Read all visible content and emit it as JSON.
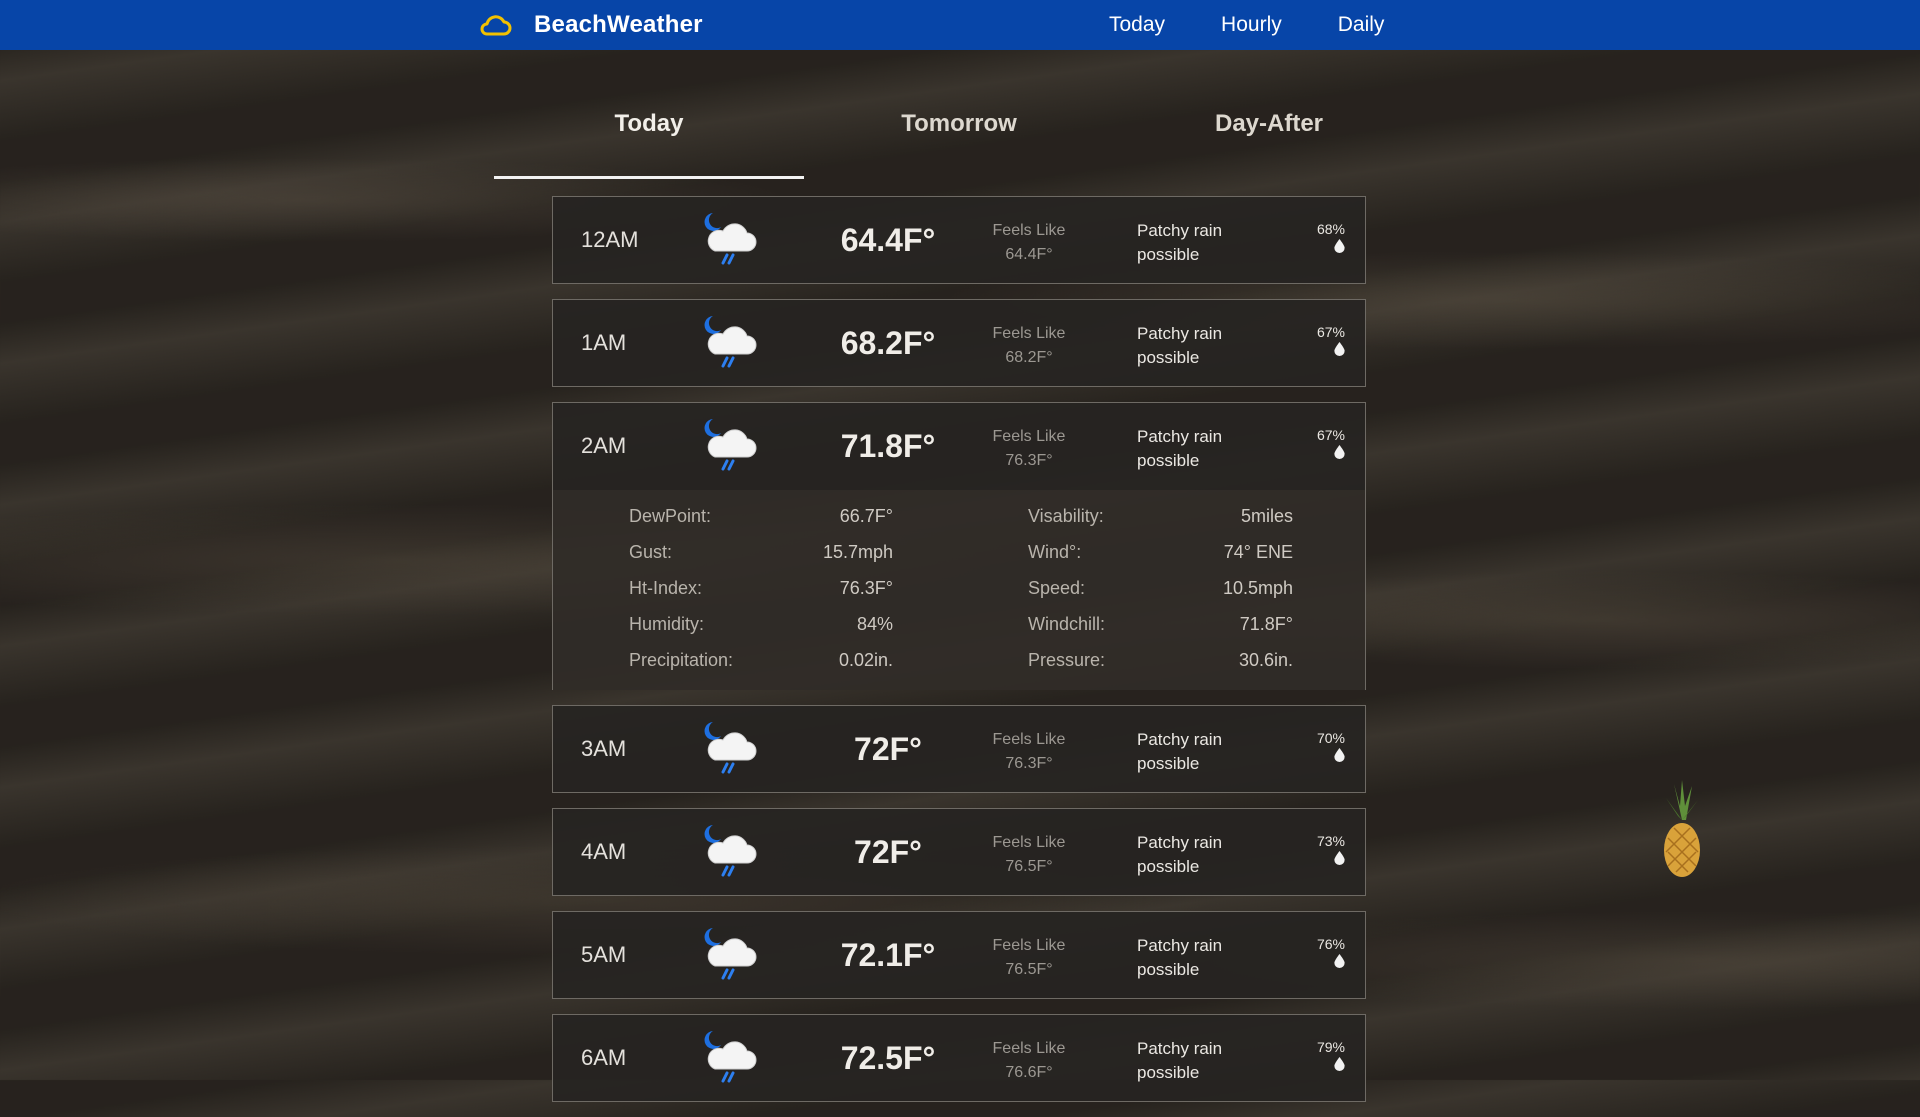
{
  "brand": {
    "name": "BeachWeather",
    "icon": "cloud-icon"
  },
  "nav": {
    "links": [
      "Today",
      "Hourly",
      "Daily"
    ]
  },
  "tabs": [
    "Today",
    "Tomorrow",
    "Day-After"
  ],
  "hours": [
    {
      "time": "12AM",
      "temp": "64.4F°",
      "feels_label": "Feels Like",
      "feels": "64.4F°",
      "condition": "Patchy rain possible",
      "chance": "68%"
    },
    {
      "time": "1AM",
      "temp": "68.2F°",
      "feels_label": "Feels Like",
      "feels": "68.2F°",
      "condition": "Patchy rain possible",
      "chance": "67%"
    },
    {
      "time": "2AM",
      "temp": "71.8F°",
      "feels_label": "Feels Like",
      "feels": "76.3F°",
      "condition": "Patchy rain possible",
      "chance": "67%"
    },
    {
      "time": "3AM",
      "temp": "72F°",
      "feels_label": "Feels Like",
      "feels": "76.3F°",
      "condition": "Patchy rain possible",
      "chance": "70%"
    },
    {
      "time": "4AM",
      "temp": "72F°",
      "feels_label": "Feels Like",
      "feels": "76.5F°",
      "condition": "Patchy rain possible",
      "chance": "73%"
    },
    {
      "time": "5AM",
      "temp": "72.1F°",
      "feels_label": "Feels Like",
      "feels": "76.5F°",
      "condition": "Patchy rain possible",
      "chance": "76%"
    },
    {
      "time": "6AM",
      "temp": "72.5F°",
      "feels_label": "Feels Like",
      "feels": "76.6F°",
      "condition": "Patchy rain possible",
      "chance": "79%"
    }
  ],
  "details": {
    "left": [
      {
        "label": "DewPoint:",
        "value": "66.7F°"
      },
      {
        "label": "Gust:",
        "value": "15.7mph"
      },
      {
        "label": "Ht-Index:",
        "value": "76.3F°"
      },
      {
        "label": "Humidity:",
        "value": "84%"
      },
      {
        "label": "Precipitation:",
        "value": "0.02in."
      }
    ],
    "right": [
      {
        "label": "Visability:",
        "value": "5miles"
      },
      {
        "label": "Wind°:",
        "value": "74° ENE"
      },
      {
        "label": "Speed:",
        "value": "10.5mph"
      },
      {
        "label": "Windchill:",
        "value": "71.8F°"
      },
      {
        "label": "Pressure:",
        "value": "30.6in."
      }
    ]
  },
  "icons": {
    "weather": "moon-cloud-rain-icon",
    "chance": "raindrop-icon",
    "decor": "pineapple-icon"
  },
  "colors": {
    "nav_bg": "#0745a8",
    "brand_icon": "#f2c100",
    "moon": "#1e6fe0",
    "rain": "#2d7ff0"
  }
}
